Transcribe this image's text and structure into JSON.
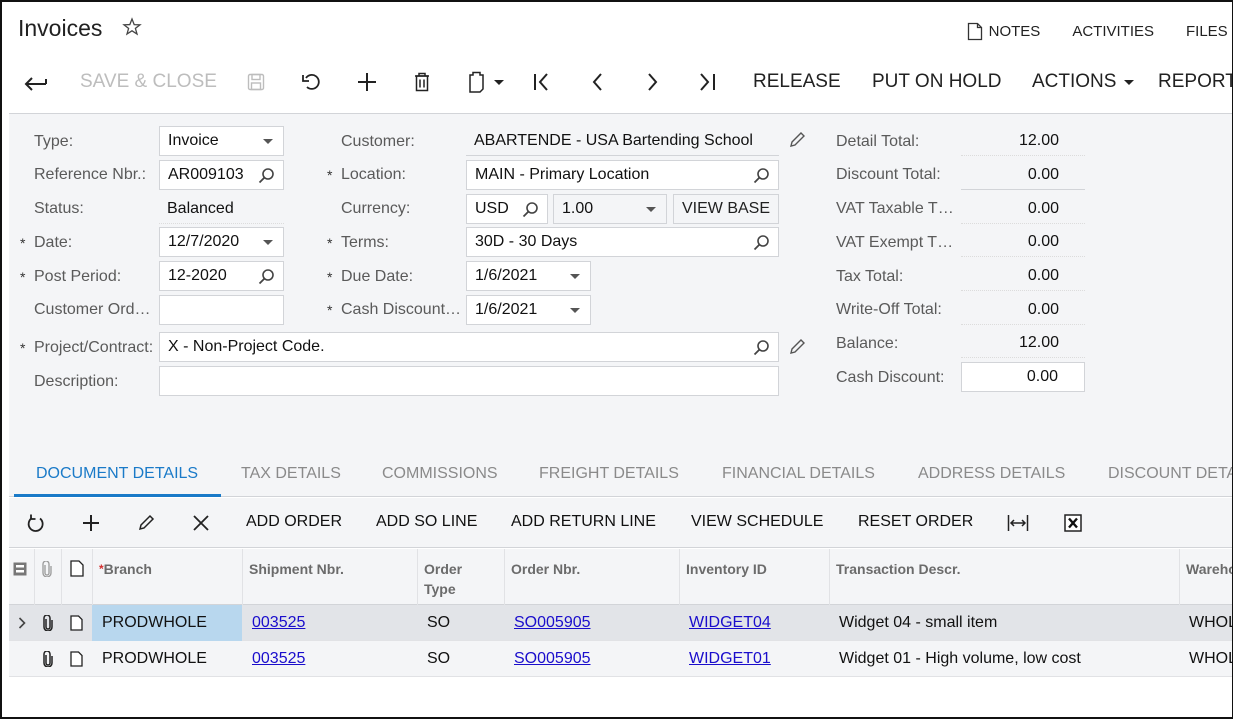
{
  "header": {
    "title": "Invoices",
    "favorite_icon": "star-outline-icon",
    "top_links": [
      {
        "label": "NOTES",
        "icon": "note-icon"
      },
      {
        "label": "ACTIVITIES"
      },
      {
        "label": "FILES"
      }
    ]
  },
  "toolbar": {
    "back_icon": "back-arrow-icon",
    "save_close_label": "SAVE & CLOSE",
    "save_icon": "floppy-disk-icon",
    "undo_icon": "undo-icon",
    "add_icon": "plus-icon",
    "delete_icon": "trash-icon",
    "copy_paste_icon": "clipboard-icon",
    "first_icon": "first-record-icon",
    "prev_icon": "previous-record-icon",
    "next_icon": "next-record-icon",
    "last_icon": "last-record-icon",
    "release_label": "RELEASE",
    "put_on_hold_label": "PUT ON HOLD",
    "actions_label": "ACTIONS",
    "reports_label": "REPORTS"
  },
  "form": {
    "type": {
      "label": "Type:",
      "value": "Invoice"
    },
    "reference_nbr": {
      "label": "Reference Nbr.:",
      "value": "AR009103"
    },
    "status": {
      "label": "Status:",
      "value": "Balanced"
    },
    "date": {
      "label": "Date:",
      "value": "12/7/2020",
      "required": true
    },
    "post_period": {
      "label": "Post Period:",
      "value": "12-2020",
      "required": true
    },
    "customer_order": {
      "label": "Customer Ord…",
      "value": ""
    },
    "project_contract": {
      "label": "Project/Contract:",
      "value": "X - Non-Project Code.",
      "required": true
    },
    "description": {
      "label": "Description:",
      "value": ""
    },
    "customer": {
      "label": "Customer:",
      "value": "ABARTENDE - USA Bartending School"
    },
    "location": {
      "label": "Location:",
      "value": "MAIN - Primary Location",
      "required": true
    },
    "currency": {
      "label": "Currency:",
      "value": "USD",
      "rate": "1.00",
      "view_base_label": "VIEW BASE"
    },
    "terms": {
      "label": "Terms:",
      "value": "30D - 30 Days",
      "required": true
    },
    "due_date": {
      "label": "Due Date:",
      "value": "1/6/2021",
      "required": true
    },
    "cash_discount_date": {
      "label": "Cash Discount…",
      "value": "1/6/2021",
      "required": true
    },
    "required_mark": "*"
  },
  "totals": {
    "detail_total": {
      "label": "Detail Total:",
      "value": "12.00"
    },
    "discount_total": {
      "label": "Discount Total:",
      "value": "0.00"
    },
    "vat_taxable": {
      "label": "VAT Taxable T…",
      "value": "0.00"
    },
    "vat_exempt": {
      "label": "VAT Exempt T…",
      "value": "0.00"
    },
    "tax_total": {
      "label": "Tax Total:",
      "value": "0.00"
    },
    "write_off_total": {
      "label": "Write-Off Total:",
      "value": "0.00"
    },
    "balance": {
      "label": "Balance:",
      "value": "12.00"
    },
    "cash_discount": {
      "label": "Cash Discount:",
      "value": "0.00"
    }
  },
  "tabs": [
    {
      "label": "DOCUMENT DETAILS",
      "active": true
    },
    {
      "label": "TAX DETAILS"
    },
    {
      "label": "COMMISSIONS"
    },
    {
      "label": "FREIGHT DETAILS"
    },
    {
      "label": "FINANCIAL DETAILS"
    },
    {
      "label": "ADDRESS DETAILS"
    },
    {
      "label": "DISCOUNT DETAILS"
    }
  ],
  "grid_toolbar": {
    "refresh_icon": "refresh-icon",
    "add_icon": "plus-icon",
    "edit_icon": "pencil-icon",
    "delete_icon": "close-x-icon",
    "add_order_label": "ADD ORDER",
    "add_so_line_label": "ADD SO LINE",
    "add_return_line_label": "ADD RETURN LINE",
    "view_schedule_label": "VIEW SCHEDULE",
    "reset_order_label": "RESET ORDER",
    "fit_columns_icon": "fit-width-icon",
    "export_excel_icon": "excel-export-icon"
  },
  "grid": {
    "columns": {
      "branch": "Branch",
      "shipment_nbr": "Shipment Nbr.",
      "order_type_1": "Order",
      "order_type_2": "Type",
      "order_nbr": "Order Nbr.",
      "inventory_id": "Inventory ID",
      "transaction_descr": "Transaction Descr.",
      "warehouse": "Warehouse"
    },
    "rows": [
      {
        "branch": "PRODWHOLE",
        "shipment_nbr": "003525",
        "order_type": "SO",
        "order_nbr": "SO005905",
        "inventory_id": "WIDGET04",
        "descr": "Widget 04 - small item",
        "warehouse": "WHOLESALE",
        "selected": true
      },
      {
        "branch": "PRODWHOLE",
        "shipment_nbr": "003525",
        "order_type": "SO",
        "order_nbr": "SO005905",
        "inventory_id": "WIDGET01",
        "descr": "Widget 01 - High volume, low cost",
        "warehouse": "WHOLESALE"
      }
    ]
  },
  "colors": {
    "accent": "#1a7ac8",
    "link": "#1a0dcc",
    "panel_bg": "#f4f5f7",
    "selected_cell": "#b8d7ee",
    "disabled_text": "#bdbdbd"
  }
}
